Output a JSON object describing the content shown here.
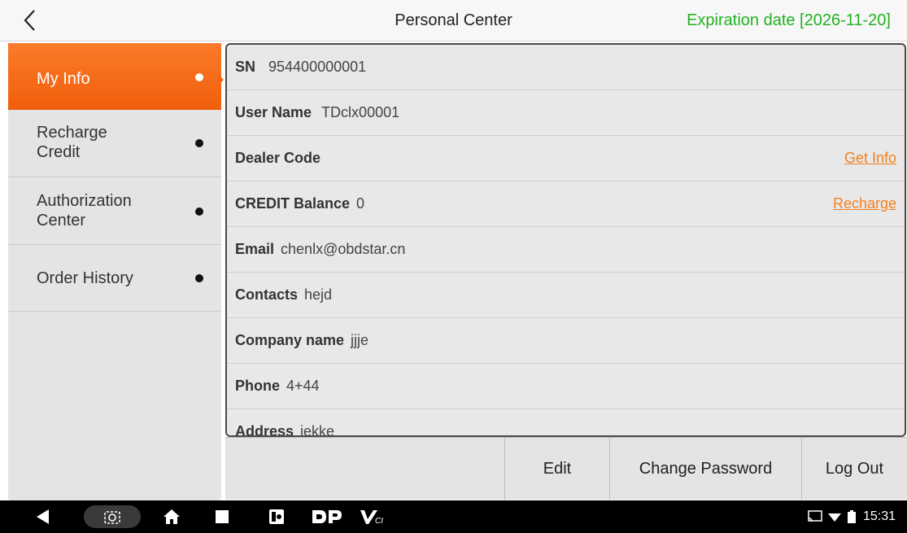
{
  "header": {
    "title": "Personal Center",
    "expiration": "Expiration date [2026-11-20]",
    "back_icon": "chevron-left-icon"
  },
  "colors": {
    "accent": "#f26a1b",
    "expiry_green": "#21b121",
    "link_orange": "#f28020"
  },
  "sidebar": {
    "items": [
      {
        "label": "My Info",
        "active": true
      },
      {
        "label": "Recharge\nCredit",
        "active": false
      },
      {
        "label": "Authorization\nCenter",
        "active": false
      },
      {
        "label": "Order History",
        "active": false
      }
    ]
  },
  "info": {
    "rows": [
      {
        "label": "SN",
        "value": "954400000001",
        "link": ""
      },
      {
        "label": "User Name",
        "value": "TDclx00001",
        "link": ""
      },
      {
        "label": "Dealer Code",
        "value": "",
        "link": "Get Info"
      },
      {
        "label": "CREDIT Balance",
        "value": "0",
        "link": "Recharge"
      },
      {
        "label": "Email",
        "value": "chenlx@obdstar.cn",
        "link": ""
      },
      {
        "label": "Contacts",
        "value": "hejd",
        "link": ""
      },
      {
        "label": "Company name",
        "value": "jjje",
        "link": ""
      },
      {
        "label": "Phone",
        "value": "4+44",
        "link": ""
      },
      {
        "label": "Address",
        "value": "jekke",
        "link": ""
      }
    ]
  },
  "buttons": {
    "edit": "Edit",
    "change_password": "Change Password",
    "logout": "Log Out"
  },
  "navbar": {
    "icons": [
      "back-triangle-icon",
      "screenshot-camera-icon",
      "home-icon",
      "recents-square-icon",
      "vci-app-icon",
      "dp-app-icon",
      "vci-logo-icon",
      "cast-icon",
      "wifi-icon",
      "battery-icon"
    ],
    "time": "15:31"
  }
}
